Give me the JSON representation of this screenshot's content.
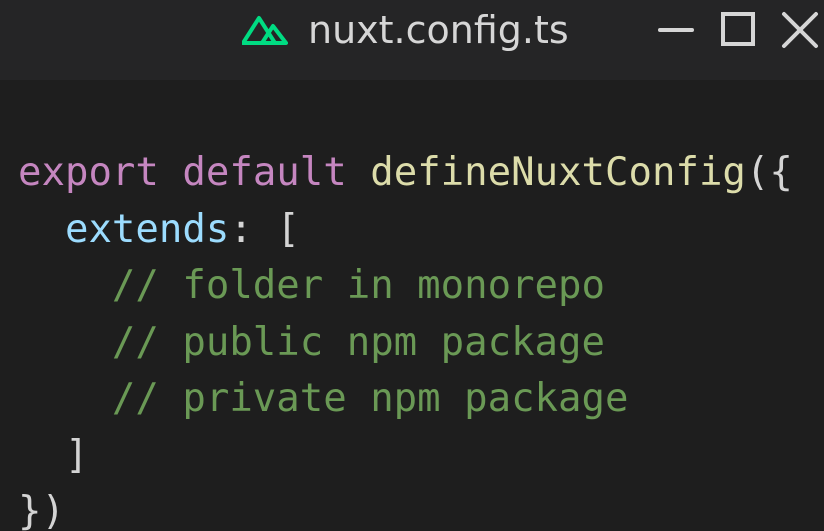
{
  "window": {
    "title": "nuxt.config.ts",
    "icon": "nuxt-logo-icon",
    "controls": {
      "minimize_icon": "minimize-icon",
      "maximize_icon": "maximize-icon",
      "close_icon": "close-icon"
    }
  },
  "colors": {
    "background": "#1e1e1e",
    "titlebar": "#252526",
    "nuxt_green": "#00dc82",
    "keyword": "#c586c0",
    "function": "#dcdcaa",
    "property": "#9cdcfe",
    "comment": "#6a9955",
    "text": "#d4d4d4"
  },
  "code": {
    "line1": {
      "export": "export",
      "default": "default",
      "fn": "defineNuxtConfig",
      "open": "({"
    },
    "line2": {
      "indent": "  ",
      "prop": "extends",
      "colon": ":",
      "open": "["
    },
    "comments": [
      "// folder in monorepo",
      "// public npm package",
      "// private npm package"
    ],
    "line6": {
      "indent": "  ",
      "close": "]"
    },
    "line7": {
      "close": "})"
    }
  }
}
